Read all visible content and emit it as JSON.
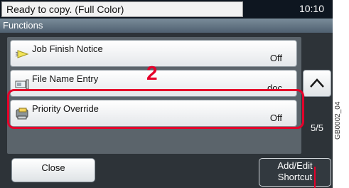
{
  "status_bar": {
    "message": "Ready to copy. (Full Color)",
    "time": "10:10"
  },
  "functions_bar": {
    "title": "Functions"
  },
  "rows": [
    {
      "label": "Job Finish Notice",
      "value": "Off",
      "icon": "bell-icon"
    },
    {
      "label": "File Name Entry",
      "value": "doc",
      "icon": "file-name-icon"
    },
    {
      "label": "Priority Override",
      "value": "Off",
      "icon": "printer-icon"
    }
  ],
  "page_indicator": "5/5",
  "buttons": {
    "close": "Close",
    "shortcut_line1": "Add/Edit",
    "shortcut_line2": "Shortcut"
  },
  "annotation": {
    "marker": "2",
    "figure_id": "GB0002_04",
    "highlight_color": "#e5002a"
  }
}
